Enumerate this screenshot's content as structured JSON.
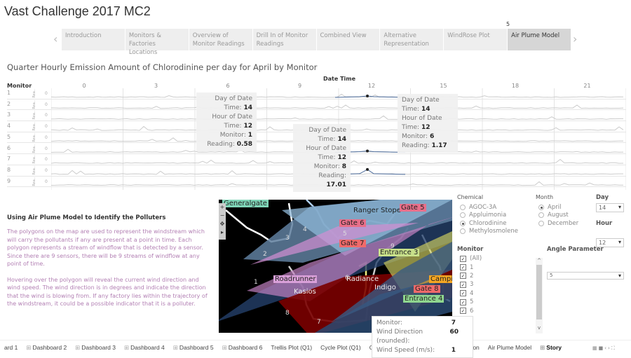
{
  "title": "Vast Challenge 2017 MC2",
  "story_nav": {
    "items": [
      "Introduction",
      "Monitors & Factories Locations",
      "Overview of Monitor Readings",
      "Drill In of Monitor Readings",
      "Combined View",
      "Alternative Representation",
      "WindRose Plot",
      "Air Plume Model"
    ],
    "active": 7,
    "counter": "5"
  },
  "chart": {
    "title": "Quarter Hourly Emission Amount of Chlorodinine per day for April by Monitor",
    "x_label": "Date Time",
    "row_header": "Monitor",
    "ticks": [
      "0",
      "3",
      "6",
      "9",
      "12",
      "15",
      "18",
      "21"
    ],
    "monitors": [
      "1",
      "2",
      "3",
      "4",
      "5",
      "6",
      "7",
      "8",
      "9"
    ],
    "axis_label": "Rea..",
    "zero": "0"
  },
  "tooltips": [
    {
      "day_label": "Day of Date",
      "time1": "Time:",
      "day": "14",
      "hour_label": "Hour of Date",
      "time2": "Time:",
      "hour": "12",
      "monitor_label": "Monitor:",
      "monitor": "1",
      "reading_label": "Reading:",
      "reading": "0.58"
    },
    {
      "day_label": "Day of Date",
      "time1": "Time:",
      "day": "14",
      "hour_label": "Hour of Date",
      "time2": "Time:",
      "hour": "12",
      "monitor_label": "Monitor:",
      "monitor": "6",
      "reading_label": "Reading:",
      "reading": "1.17"
    },
    {
      "day_label": "Day of Date",
      "time1": "Time:",
      "day": "14",
      "hour_label": "Hour of Date",
      "time2": "Time:",
      "hour": "12",
      "monitor_label": "Monitor:",
      "monitor": "8",
      "reading_label": "Reading:",
      "reading": "17.01"
    }
  ],
  "left_panel": {
    "heading": "Using Air Plume Model to Identify the Polluters",
    "p1": "The polygons on the map are used to represent the windstream which will carry the pollutants if any are present at a point in time. Each polygon represents a stream of windflow that is detected by a sensor. Since there are 9 sensors, there will be 9 streams of windflow at any point of time.",
    "p2": "Hovering over the polygon will reveal the current wind direction and wind speed. The wind direction is in degrees and indicate the direction that the wind is blowing from. If any factory lies within the trajectory of the windstream, it could be a possible indicator that it is a polluter."
  },
  "map": {
    "factories": [
      {
        "name": "Generalgate",
        "color": "#7fd6b8"
      },
      {
        "name": "Ranger Stope",
        "color": "#7fa8c8"
      },
      {
        "name": "Gate 5",
        "color": "#e86f8a"
      },
      {
        "name": "Gate 6",
        "color": "#e86f8a"
      },
      {
        "name": "Gate 7",
        "color": "#f06a6a"
      },
      {
        "name": "Entrance 3",
        "color": "#c8e08a"
      },
      {
        "name": "Roadrunner",
        "color": "#d9a0d9"
      },
      {
        "name": "Radiance",
        "color": "#ffffff"
      },
      {
        "name": "Kasios",
        "color": "#ffffff"
      },
      {
        "name": "Indigo",
        "color": "#ffffff"
      },
      {
        "name": "Camping",
        "color": "#f5a623"
      },
      {
        "name": "Gate 8",
        "color": "#f06a6a"
      },
      {
        "name": "Entrance 4",
        "color": "#8fd68f"
      }
    ],
    "monitors": [
      "1",
      "2",
      "3",
      "4",
      "5",
      "6",
      "7",
      "8",
      "9"
    ]
  },
  "map_tooltip": {
    "monitor_label": "Monitor:",
    "monitor": "7",
    "direction_label": "Wind Direction (rounded):",
    "direction": "60",
    "speed_label": "Wind Speed (m/s):",
    "speed": "1"
  },
  "filters": {
    "chemical": {
      "label": "Chemical",
      "options": [
        "AGOC-3A",
        "Appluimonia",
        "Chlorodinine",
        "Methylosmolene"
      ],
      "selected": 2
    },
    "month": {
      "label": "Month",
      "options": [
        "April",
        "August",
        "December"
      ],
      "selected": 0
    },
    "day": {
      "label": "Day",
      "value": "14"
    },
    "hour": {
      "label": "Hour",
      "value": "12"
    },
    "monitor": {
      "label": "Monitor",
      "options": [
        "(All)",
        "1",
        "2",
        "3",
        "4",
        "5",
        "6"
      ]
    },
    "angle": {
      "label": "Angle Parameter",
      "value": "5"
    }
  },
  "tabs": {
    "items": [
      "ard 1",
      "Dashboard 2",
      "Dashboard 3",
      "Dashboard 4",
      "Dashboard 5",
      "Dashboard 6",
      "Trellis Plot (Q1)",
      "Cycle Plot (Q1)",
      "Cycl",
      "Direction",
      "Air Plume Model",
      "Story"
    ],
    "active": 11
  }
}
